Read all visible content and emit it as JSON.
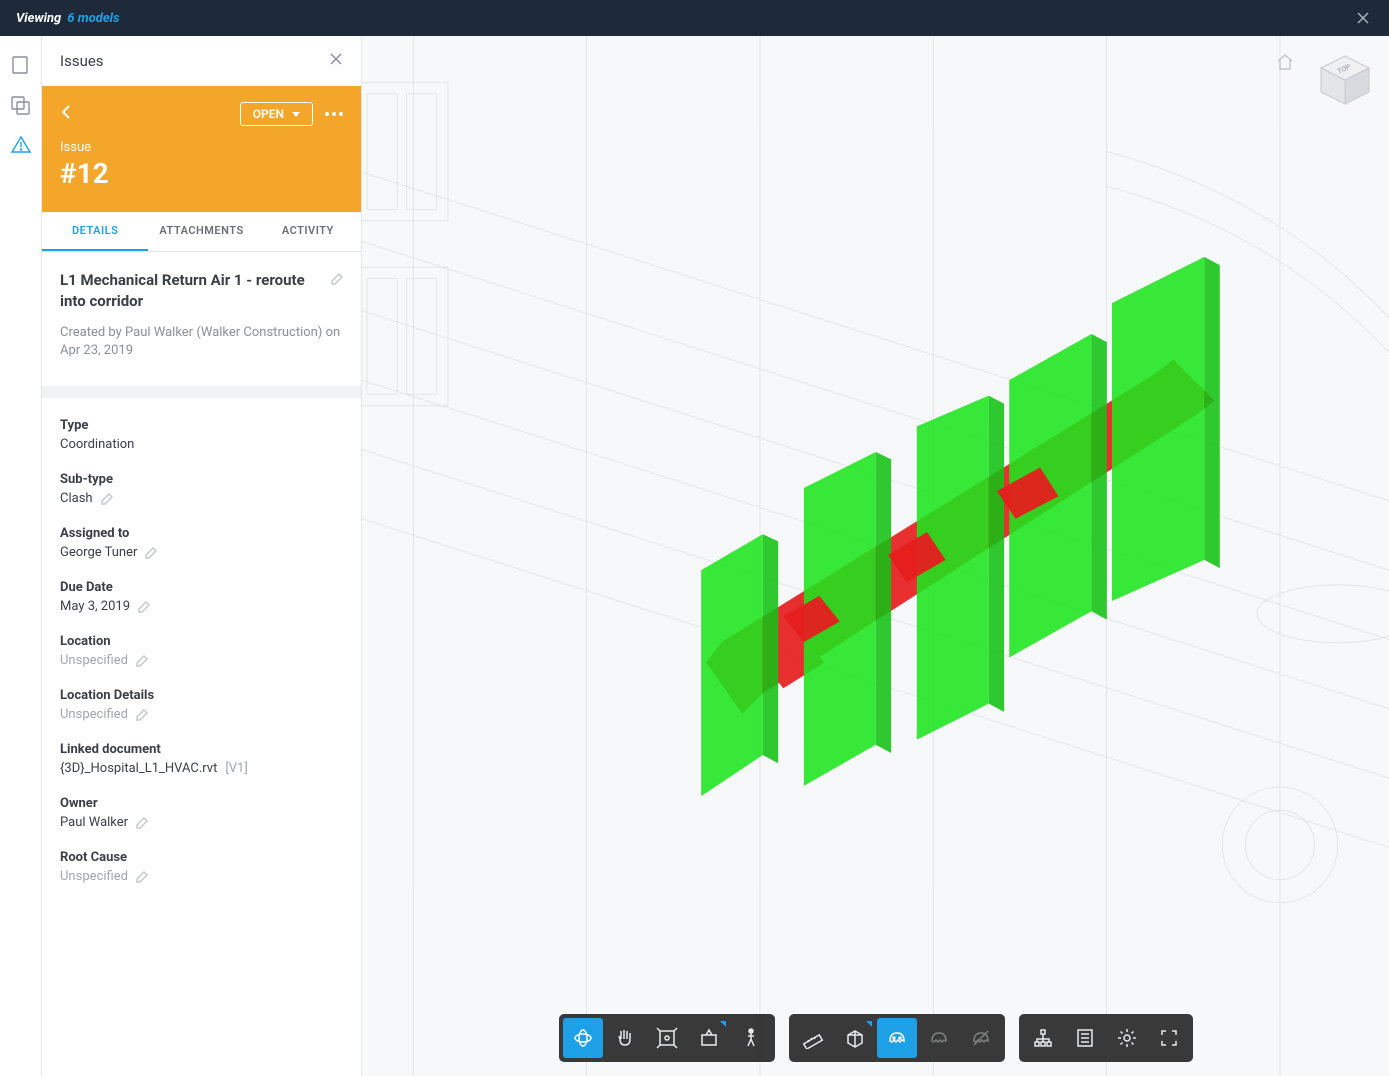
{
  "topbar": {
    "label": "Viewing",
    "count": "6 models"
  },
  "panel": {
    "title": "Issues",
    "issue_label": "Issue",
    "issue_number": "#12",
    "status": "OPEN",
    "tabs": {
      "details": "DETAILS",
      "attachments": "ATTACHMENTS",
      "activity": "ACTIVITY"
    }
  },
  "issue": {
    "title": "L1 Mechanical Return Air 1 - reroute into corridor",
    "created_by": "Created by Paul Walker (Walker Construction) on Apr 23, 2019",
    "fields": {
      "type": {
        "label": "Type",
        "value": "Coordination"
      },
      "subtype": {
        "label": "Sub-type",
        "value": "Clash"
      },
      "assigned": {
        "label": "Assigned to",
        "value": "George Tuner"
      },
      "due": {
        "label": "Due Date",
        "value": "May 3, 2019"
      },
      "location": {
        "label": "Location",
        "value": "Unspecified"
      },
      "location_details": {
        "label": "Location Details",
        "value": "Unspecified"
      },
      "linked_doc": {
        "label": "Linked document",
        "value": "{3D}_Hospital_L1_HVAC.rvt",
        "version": "[V1]"
      },
      "owner": {
        "label": "Owner",
        "value": "Paul Walker"
      },
      "root_cause": {
        "label": "Root Cause",
        "value": "Unspecified"
      }
    }
  },
  "colors": {
    "green": "#1ee61e",
    "red": "#e61e1e",
    "accent": "#1ea0e6",
    "warn": "#f4a62a"
  },
  "viewcube": {
    "face": "TOP"
  }
}
